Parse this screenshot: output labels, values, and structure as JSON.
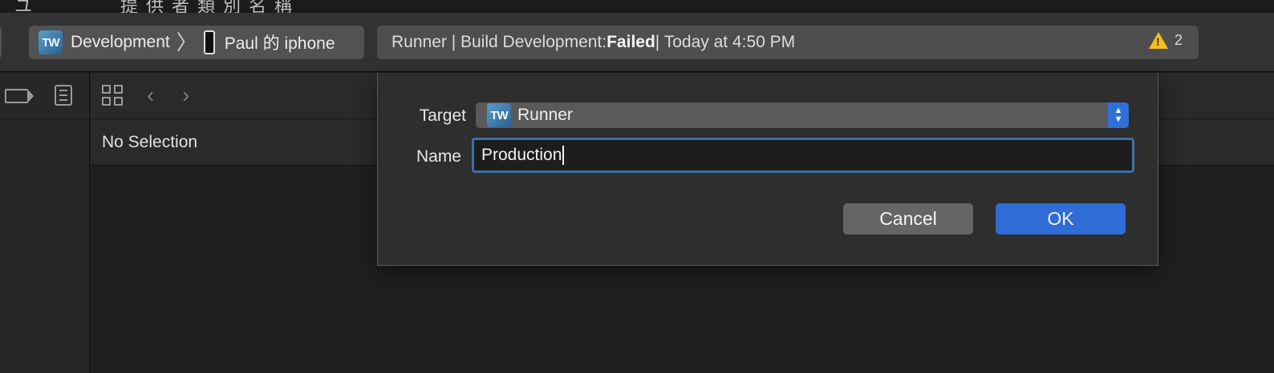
{
  "background_strip": {
    "clipped_text_1": "ユ",
    "clipped_text_2": "提供者類別名稱"
  },
  "toolbar": {
    "scheme": {
      "icon_text": "TW",
      "target": "Development",
      "separator": "〉",
      "device": "Paul 的 iphone"
    },
    "status": {
      "prefix": "Runner | Build Development: ",
      "result": "Failed",
      "suffix": " | Today at 4:50 PM",
      "warning_count": "2"
    }
  },
  "editor": {
    "nav_back": "‹",
    "nav_forward": "›",
    "jump_bar": "No Selection"
  },
  "dialog": {
    "target_label": "Target",
    "target_icon_text": "TW",
    "target_value": "Runner",
    "name_label": "Name",
    "name_value": "Production",
    "cancel_label": "Cancel",
    "ok_label": "OK"
  },
  "colors": {
    "accent_blue": "#2f6cd6",
    "focus_ring": "#3f6fa8",
    "warning_yellow": "#f5bd1f"
  }
}
